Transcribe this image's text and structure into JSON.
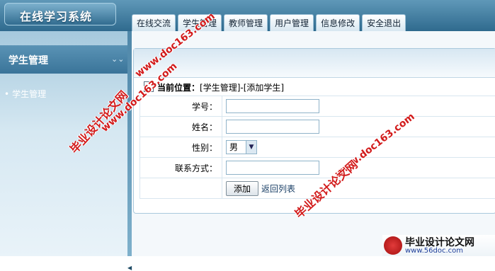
{
  "header": {
    "logo_text": "在线学习系统",
    "tabs": [
      "在线交流",
      "学生管理",
      "教师管理",
      "用户管理",
      "信息修改",
      "安全退出"
    ]
  },
  "sidebar": {
    "title": "学生管理",
    "items": [
      {
        "bullet": "•",
        "label": "学生管理"
      }
    ]
  },
  "main": {
    "location_label": "当前位置：",
    "location_path": "[学生管理]-[添加学生]",
    "form": {
      "fields": [
        {
          "label": "学号：",
          "value": ""
        },
        {
          "label": "姓名：",
          "value": ""
        },
        {
          "label": "性别：",
          "value": "男"
        },
        {
          "label": "联系方式：",
          "value": ""
        }
      ],
      "submit_label": "添加",
      "back_link": "返回列表"
    }
  },
  "watermarks": [
    "www.doc163.com",
    "毕业设计论文网",
    "www.doc163.com",
    "www.doc163.com",
    "毕业设计论文网",
    "毕业设计论文网",
    "www.56doc.com"
  ],
  "colors": {
    "header": "#2f6a8e",
    "sidebar_title": "#3a7499",
    "watermark": "#d21b1b"
  }
}
